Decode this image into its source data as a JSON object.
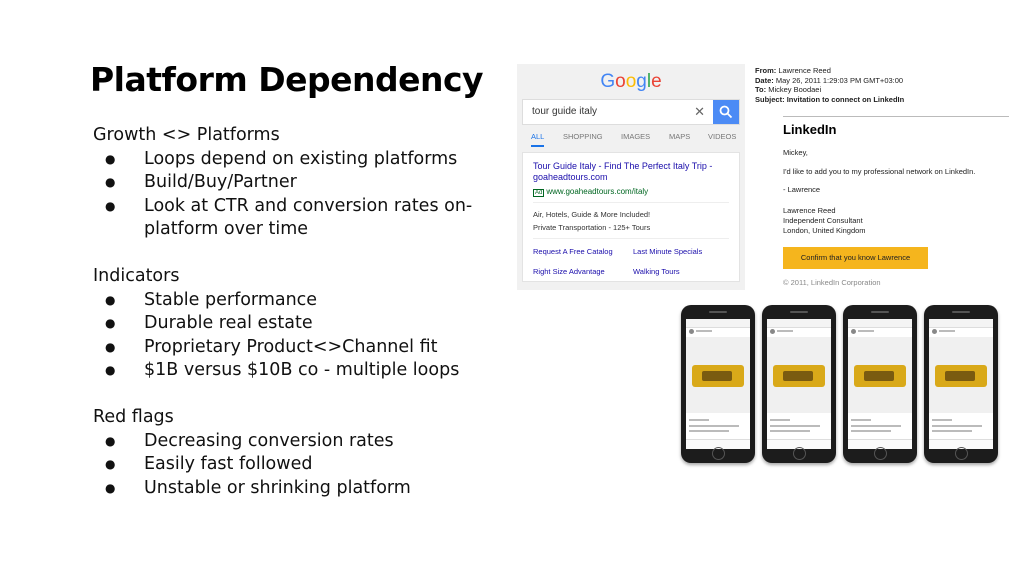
{
  "slide": {
    "title": "Platform Dependency",
    "sections": [
      {
        "heading": "Growth <> Platforms",
        "bullets": [
          "Loops depend on existing platforms",
          "Build/Buy/Partner",
          "Look at CTR and conversion rates on-platform over time"
        ]
      },
      {
        "heading": "Indicators",
        "bullets": [
          "Stable performance",
          "Durable real estate",
          "Proprietary Product<>Channel fit",
          "$1B versus $10B co - multiple loops"
        ]
      },
      {
        "heading": "Red flags",
        "bullets": [
          "Decreasing conversion rates",
          "Easily fast followed",
          "Unstable or shrinking platform"
        ]
      }
    ]
  },
  "google": {
    "logo_letters": [
      "G",
      "o",
      "o",
      "g",
      "l",
      "e"
    ],
    "query": "tour guide italy",
    "clear_glyph": "✕",
    "tabs": [
      "ALL",
      "SHOPPING",
      "IMAGES",
      "MAPS",
      "VIDEOS"
    ],
    "ad_title": "Tour Guide Italy - Find The Perfect Italy Trip - goaheadtours.com",
    "ad_badge": "Ad",
    "ad_url": "www.goaheadtours.com/italy",
    "desc_line1": "Air, Hotels, Guide & More Included!",
    "desc_line2": "Private Transportation - 125+ Tours",
    "sitelinks": [
      "Request A Free Catalog",
      "Last Minute Specials",
      "Right Size Advantage",
      "Walking Tours"
    ],
    "accent_color": "#4c8bf5"
  },
  "email": {
    "from_label": "From:",
    "from_value": "Lawrence Reed",
    "date_label": "Date:",
    "date_value": "May 26, 2011 1:29:03 PM GMT+03:00",
    "to_label": "To:",
    "to_value": "Mickey Boodaei",
    "subject_label": "Subject:",
    "subject_value": "Invitation to connect on LinkedIn",
    "logo": "LinkedIn",
    "greeting": "Mickey,",
    "body": "I'd like to add you to my professional network on LinkedIn.",
    "signoff": "- Lawrence",
    "sig_name": "Lawrence Reed",
    "sig_title": "Independent Consultant",
    "sig_location": "London, United Kingdom",
    "button_label": "Confirm that you know Lawrence",
    "footer": "© 2011, LinkedIn Corporation",
    "button_color": "#f5b51d"
  },
  "phones": {
    "count": 4
  }
}
